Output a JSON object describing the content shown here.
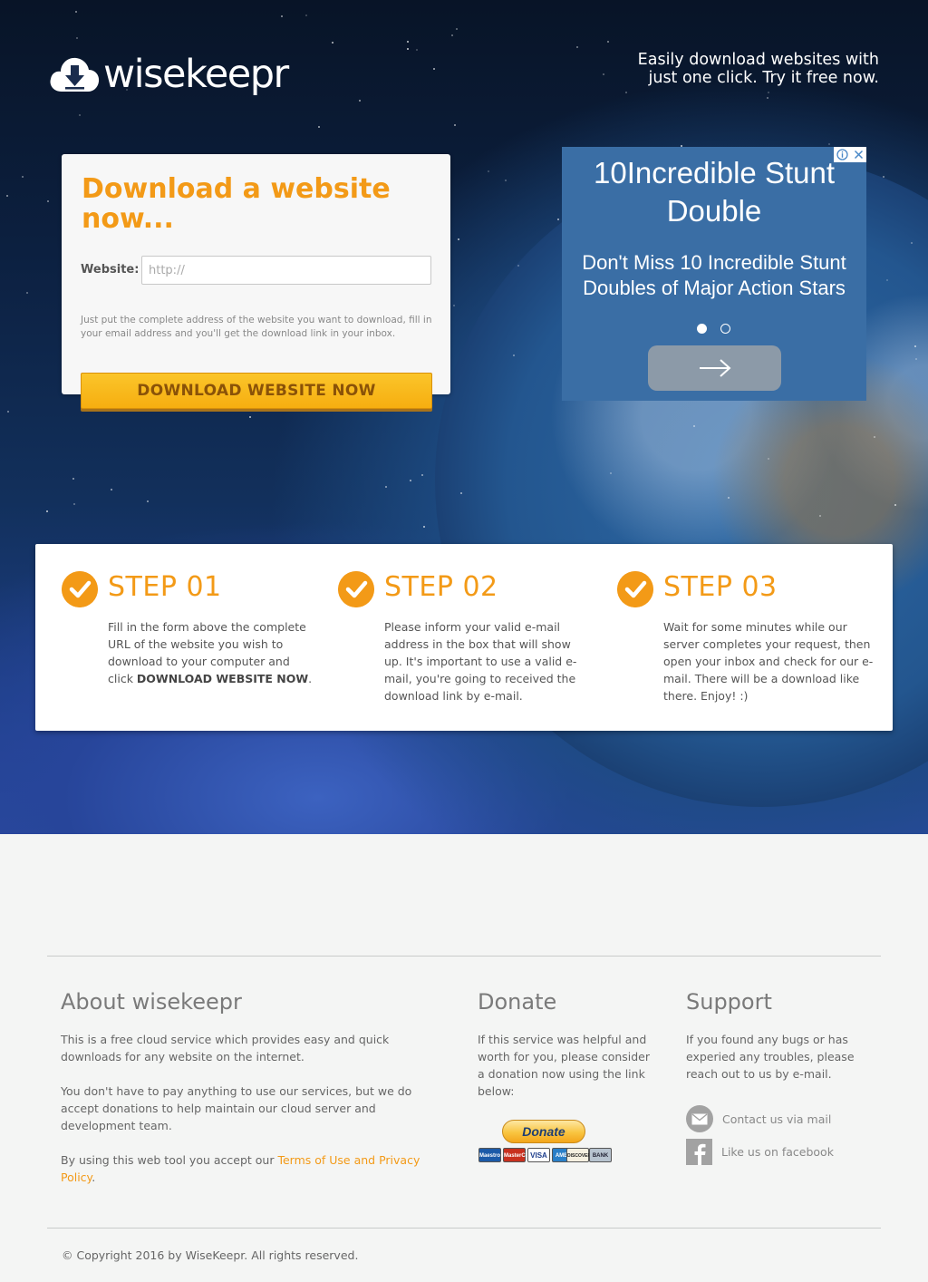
{
  "header": {
    "logo_text": "wisekeepr",
    "tagline_line1": "Easily download websites with",
    "tagline_line2": "just one click. Try it free now."
  },
  "form": {
    "title": "Download a website now...",
    "website_label": "Website:",
    "website_placeholder": "http://",
    "website_value": "",
    "help_text": "Just put the complete address of the website you want to download, fill in your email address and you'll get the download link in your inbox.",
    "submit_label": "DOWNLOAD WEBSITE NOW"
  },
  "ad": {
    "title": "10Incredible Stunt Double",
    "body": "Don't Miss 10 Incredible Stunt Doubles of Major Action Stars",
    "slides": 2,
    "active_slide": 1
  },
  "steps": [
    {
      "title": "STEP 01",
      "text_before": "Fill in the form above the complete URL of the website you wish to download to your computer and click ",
      "text_bold": "DOWNLOAD WEBSITE NOW",
      "text_after": "."
    },
    {
      "title": "STEP 02",
      "text": "Please inform your valid e-mail address in the box that will show up. It's important to use a valid e-mail, you're going to received the download link by e-mail."
    },
    {
      "title": "STEP 03",
      "text": "Wait for some minutes while our server completes your request, then open your inbox and check for our e-mail. There will be a download like there. Enjoy! :)"
    }
  ],
  "footer": {
    "about": {
      "heading": "About wisekeepr",
      "p1": "This is a free cloud service which provides easy and quick downloads for any website on the internet.",
      "p2": "You don't have to pay anything to use our services, but we do accept donations to help maintain our cloud server and development team.",
      "p3_before": "By using this web tool you accept our ",
      "p3_link": "Terms of Use and Privacy Policy",
      "p3_after": "."
    },
    "donate": {
      "heading": "Donate",
      "text": "If this service was helpful and worth for you, please consider a donation now using the link below:",
      "button_label": "Donate",
      "cards": [
        "Maestro",
        "MasterCard",
        "VISA",
        "AMEX",
        "DISCOVER",
        "BANK"
      ]
    },
    "support": {
      "heading": "Support",
      "text": "If you found any bugs or has experied any troubles, please reach out to us by e-mail.",
      "mail_label": "Contact us via mail",
      "facebook_label": "Like us on facebook"
    },
    "copyright": "© Copyright 2016 by WiseKeepr. All rights reserved."
  },
  "colors": {
    "accent": "#f39a17",
    "button": "#f6ae10",
    "ad_bg": "#3a6ea5"
  }
}
